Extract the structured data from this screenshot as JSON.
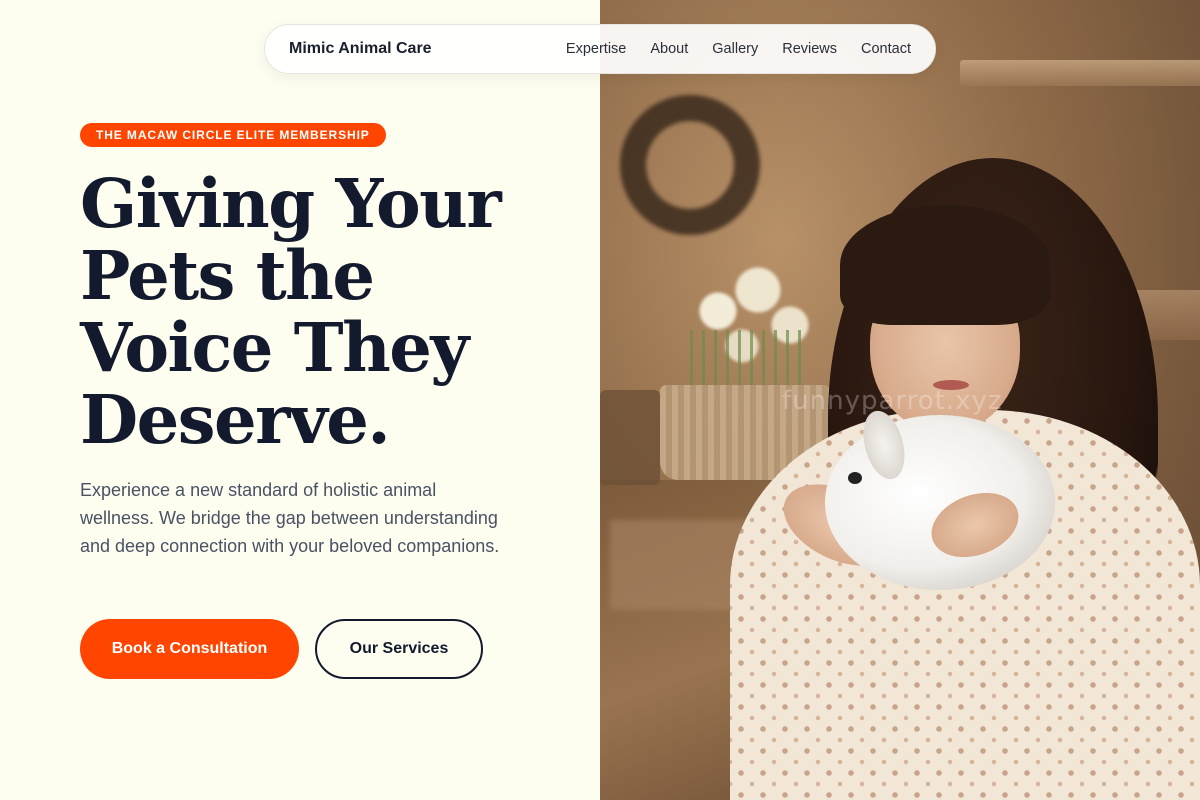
{
  "nav": {
    "brand": "Mimic Animal Care",
    "links": [
      "Expertise",
      "About",
      "Gallery",
      "Reviews",
      "Contact"
    ]
  },
  "hero": {
    "badge": "THE MACAW CIRCLE ELITE MEMBERSHIP",
    "headline_lines": [
      "Giving Your",
      "Pets the",
      "Voice They",
      "Deserve."
    ],
    "subtext": "Experience a new standard of holistic animal wellness. We bridge the gap between understanding and deep connection with your beloved companions.",
    "primary_cta": "Book a Consultation",
    "secondary_cta": "Our Services"
  },
  "photo": {
    "watermark": "funnyparrot.xyz"
  },
  "colors": {
    "accent": "#ff4500",
    "heading": "#131a2e",
    "background": "#fdfdf0"
  }
}
